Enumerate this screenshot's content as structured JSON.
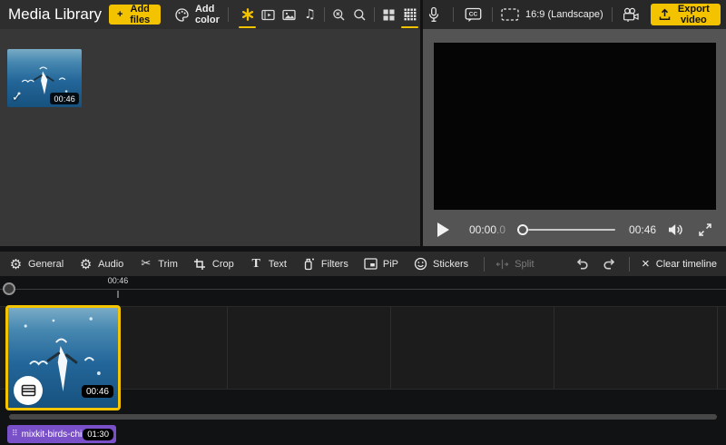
{
  "colors": {
    "accent": "#f3c300",
    "audio_clip": "#7a50c8",
    "selection_border": "#f5c400"
  },
  "glyphs": {
    "plus": "+",
    "check": "✓",
    "close": "×",
    "gear": "⚙",
    "scissors": "✂",
    "music": "♫",
    "braille": "⠿",
    "chevron_left": "‹",
    "cc": "CC",
    "text_T": "T"
  },
  "media_panel": {
    "title": "Media Library",
    "add_files": "Add files",
    "add_color": "Add color",
    "tabs": [
      "favorites-star",
      "video-clips",
      "images",
      "audio",
      "search-clear",
      "search",
      "grid-large",
      "grid-dense"
    ],
    "active_tabs": [
      "favorites-star",
      "grid-dense"
    ],
    "item": {
      "duration": "00:46",
      "selected": true
    }
  },
  "preview": {
    "topbar_icons": [
      "microphone",
      "captions-cc",
      "aspect-ratio",
      "camera"
    ],
    "aspect_label": "16:9 (Landscape)",
    "export_label": "Export video",
    "time_current": "00:00",
    "time_fraction": ".0",
    "time_total": "00:46"
  },
  "edit_toolbar": {
    "buttons": [
      {
        "label": "General",
        "icon": "gear"
      },
      {
        "label": "Audio",
        "icon": "gear"
      },
      {
        "label": "Trim",
        "icon": "scissors"
      },
      {
        "label": "Crop",
        "icon": "crop"
      },
      {
        "label": "Text",
        "icon": "letter-T"
      },
      {
        "label": "Filters",
        "icon": "filter-bottle"
      },
      {
        "label": "PiP",
        "icon": "picture-in-picture"
      },
      {
        "label": "Stickers",
        "icon": "smiley"
      }
    ],
    "split": {
      "label": "Split",
      "disabled": true
    },
    "undo": "undo",
    "redo": "redo",
    "clear": "Clear timeline"
  },
  "timeline": {
    "ruler_time": "00:46",
    "clip": {
      "duration": "00:46",
      "selected": true
    },
    "audio_track": {
      "name": "mixkit-birds-chir...",
      "duration": "01:30"
    }
  }
}
